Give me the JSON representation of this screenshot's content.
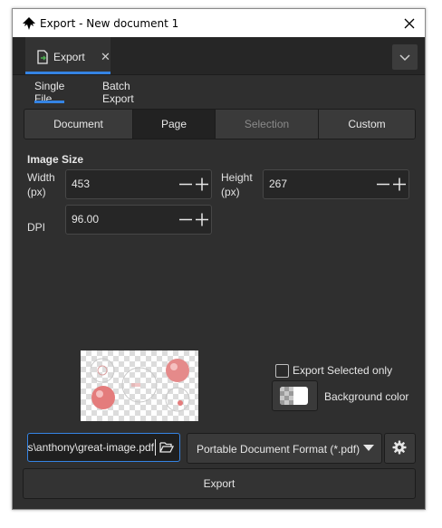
{
  "window": {
    "title": "Export - New document 1"
  },
  "tab": {
    "label": "Export"
  },
  "subtabs": [
    {
      "label": "Single File",
      "active": true
    },
    {
      "label": "Batch Export",
      "active": false
    }
  ],
  "areas": [
    {
      "label": "Document",
      "state": "normal"
    },
    {
      "label": "Page",
      "state": "selected"
    },
    {
      "label": "Selection",
      "state": "disabled"
    },
    {
      "label": "Custom",
      "state": "normal"
    }
  ],
  "image_size": {
    "title": "Image Size",
    "width_label": "Width\n(px)",
    "width_value": "453",
    "height_label": "Height\n(px)",
    "height_value": "267",
    "dpi_label": "DPI",
    "dpi_value": "96.00"
  },
  "options": {
    "export_selected_only": "Export Selected only",
    "background_color": "Background color"
  },
  "file": {
    "filename": "C:\\Users\\anthony\\great-image.pdf",
    "format": "Portable Document Format (*.pdf)"
  },
  "actions": {
    "export": "Export"
  },
  "colors": {
    "accent": "#3584e4",
    "panel": "#2f2f2f"
  }
}
